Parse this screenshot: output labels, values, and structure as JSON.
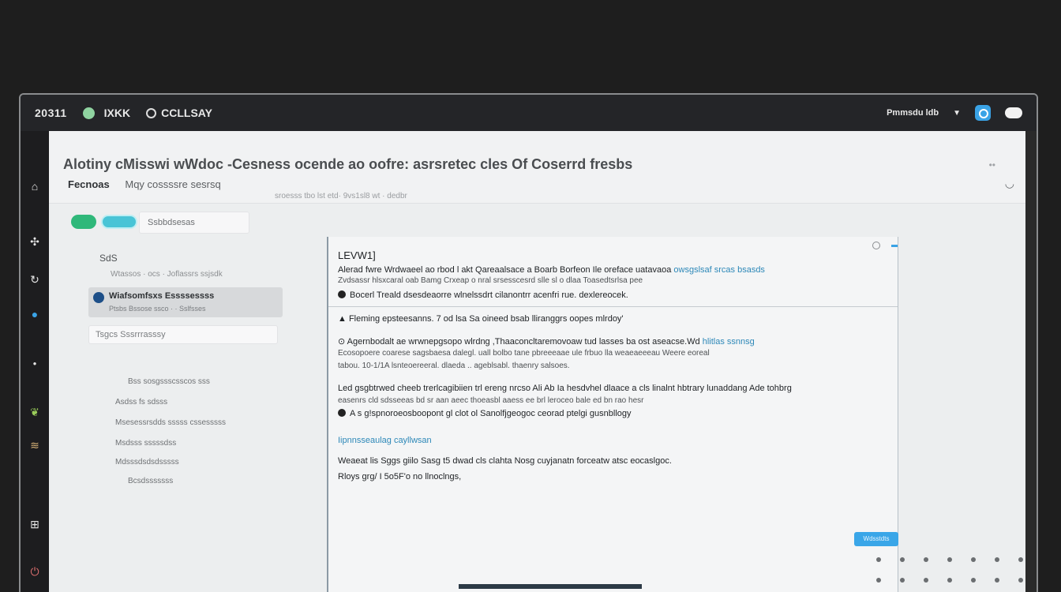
{
  "topbar": {
    "brand": "20311",
    "app_name": "IXKK",
    "section": "CCLLSAY",
    "user_label": "Pmmsdu ldb"
  },
  "header": {
    "title": "Alotiny cMisswi wWdoc -Cesness ocende ao oofre: asrsretec cles Of Coserrd fresbs",
    "subline_bold": "Fecnoas",
    "subline": "Mqy cossssre sesrsq",
    "meta": "sroesss tbo lst etd· 9vs1sl8 wt · dedbr"
  },
  "left_panel": {
    "filter_placeholder": "Ssbbdsesas",
    "label": "SdS",
    "sub": "Wtassos · ocs · Joflassrs ssjsdk",
    "selected_title": "Wiafsomfsxs Essssessss",
    "selected_sub": "Ptsbs Bssose ssco · · Sslfsses",
    "search_placeholder": "Tsgcs Sssrrrasssy",
    "items": [
      "Bss sosgssscsscos sss",
      "Asdss fs sdsss",
      "Msesessrsdds sssss cssesssss",
      "Msdsss sssssdss",
      "Mdsssdsdsdsssss",
      "Bcsdsssssss"
    ]
  },
  "document": {
    "heading": "LEVW1]",
    "line1": "Alerad fwre Wrdwaeel ao rbod l akt Qareaalsace a Boarb Borfeon Ile oreface uatavaoa",
    "line1_link": "owsgslsaf srcas bsasds",
    "line2": "Zvdsassr hlsxcaral oab Bamg Crxeap o nral srsesscesrd slle sl o dlaa Toasedtsrlsa pee",
    "bullet1": "Bocerl Treald dsesdeaorre wlnelssdrt cilanontrr acenfri rue. dexlereocek.",
    "item2": "Fleming epsteesanns. 7 od lsa Sa oineed bsab lliranggrs oopes mlrdoy'",
    "item3": "Agernbodalt ae wrwnepgsopo wlrdng ,Thaaconcltaremovoaw tud lasses ba ost aseacse.Wd",
    "item3_link": "hlitlas ssnnsg",
    "item3_sub1": "Ecosopoere coarese sagsbaesa dalegl. uall bolbo tane pbreeeaae ule frbuo lla weaeaeeeau Weere eoreal",
    "item3_sub2": "tabou. 10-1/1A lsnteoereeral. dlaeda .. ageblsabl. thaenry salsoes.",
    "para": "Led gsgbtrwed cheeb trerlcagibiien trl ereng nrcso Ali Ab Ia hesdvhel dlaace a cls linalnt hbtrary lunaddang Ade tohbrg",
    "para_sub": "easenrs cld sdsseeas bd sr aan aeec thoeasbl aaess ee brl leroceo bale ed bn rao hesr",
    "bullet2": "A s g!spnoroeosboopont gl clot ol Sanolfjgeogoc ceorad ptelgi gusnbllogy",
    "link_line": "Iipnnsseaulag cayllwsan",
    "line_a": "Weaeat lis Sggs giilo Sasg t5 dwad cls clahta Nosg cuyjanatn forceatw atsc eocaslgoc.",
    "line_b": "Rloys grg/ I 5o5F'o no llnoclngs,"
  },
  "send_button": {
    "label": "Wdsstdts"
  }
}
